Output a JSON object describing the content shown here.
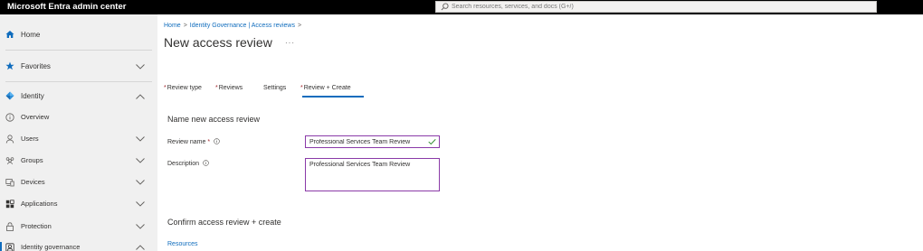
{
  "app": {
    "title": "Microsoft Entra admin center"
  },
  "search": {
    "placeholder": "Search resources, services, and docs (G+/)"
  },
  "sidebar": {
    "items": [
      {
        "label": "Home",
        "icon": "home-icon"
      },
      {
        "label": "Favorites",
        "icon": "star-icon"
      },
      {
        "label": "Identity",
        "icon": "identity-diamond-icon"
      },
      {
        "label": "Overview",
        "icon": "info-circle-icon"
      },
      {
        "label": "Users",
        "icon": "person-icon"
      },
      {
        "label": "Groups",
        "icon": "groups-icon"
      },
      {
        "label": "Devices",
        "icon": "devices-icon"
      },
      {
        "label": "Applications",
        "icon": "grid-apps-icon"
      },
      {
        "label": "Protection",
        "icon": "lock-icon"
      },
      {
        "label": "Identity governance",
        "icon": "governance-icon"
      }
    ]
  },
  "breadcrumb": {
    "items": [
      "Home",
      "Identity Governance | Access reviews"
    ]
  },
  "page": {
    "title": "New access review",
    "more": "···"
  },
  "tabs": [
    {
      "label": "Review type",
      "required": "*"
    },
    {
      "label": "Reviews",
      "required": "*"
    },
    {
      "label": "Settings",
      "required": ""
    },
    {
      "label": "Review + Create",
      "required": "*"
    }
  ],
  "form": {
    "section_title": "Name new access review",
    "review_name_label": "Review name",
    "required_mark": "*",
    "review_name_value": "Professional Services Team Review",
    "description_label": "Description",
    "description_value": "Professional Services Team Review"
  },
  "confirm": {
    "section_title": "Confirm access review + create",
    "resources_link": "Resources"
  },
  "colors": {
    "accent": "#0f6cbd",
    "topbar": "#000000",
    "sidebar": "#f0f0f0",
    "input_border": "#8a3aa8"
  }
}
